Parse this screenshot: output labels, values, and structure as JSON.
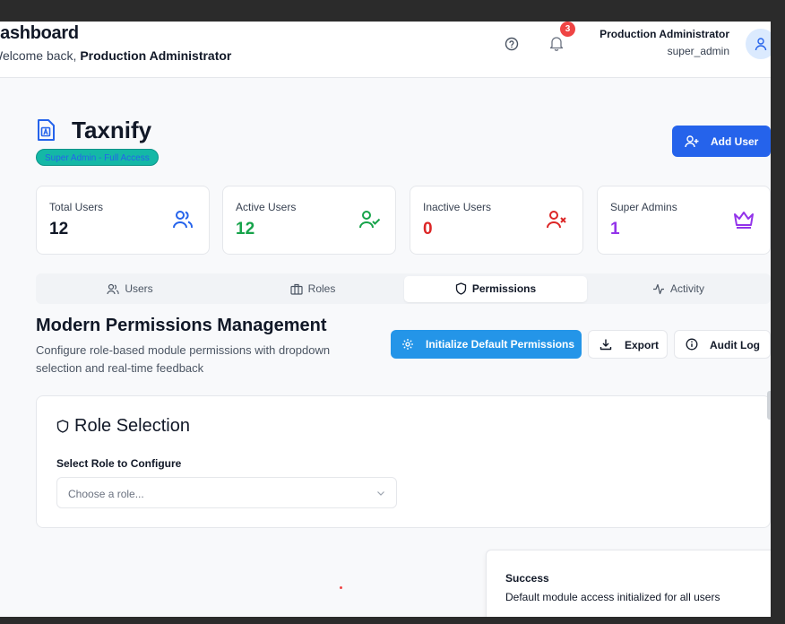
{
  "header": {
    "title": "Dashboard",
    "welcome_prefix": "Welcome back, ",
    "welcome_name": "Production Administrator",
    "notification_count": "3",
    "user_name": "Production Administrator",
    "user_role": "super_admin"
  },
  "brand": {
    "name": "Taxnify",
    "badge": "Super Admin - Full Access",
    "add_user_label": "Add User"
  },
  "stats": [
    {
      "label": "Total Users",
      "value": "12",
      "color": "#111827",
      "icon": "users-icon"
    },
    {
      "label": "Active Users",
      "value": "12",
      "color": "#16a34a",
      "icon": "user-check-icon"
    },
    {
      "label": "Inactive Users",
      "value": "0",
      "color": "#dc2626",
      "icon": "user-x-icon"
    },
    {
      "label": "Super Admins",
      "value": "1",
      "color": "#9333ea",
      "icon": "crown-icon"
    }
  ],
  "tabs": [
    {
      "label": "Users",
      "icon": "users-icon",
      "active": false
    },
    {
      "label": "Roles",
      "icon": "briefcase-icon",
      "active": false
    },
    {
      "label": "Permissions",
      "icon": "shield-icon",
      "active": true
    },
    {
      "label": "Activity",
      "icon": "activity-icon",
      "active": false
    }
  ],
  "section": {
    "title": "Modern Permissions Management",
    "description": "Configure role-based module permissions with dropdown selection and real-time feedback",
    "init_label": "Initialize Default Permissions",
    "export_label": "Export",
    "audit_label": "Audit Log"
  },
  "role_card": {
    "title": "Role Selection",
    "field_label": "Select Role to Configure",
    "placeholder": "Choose a role..."
  },
  "toast": {
    "title": "Success",
    "message": "Default module access initialized for all users"
  },
  "colors": {
    "primary": "#2563eb",
    "init_button": "#2495e8",
    "badge_bg": "#14b8a6"
  }
}
